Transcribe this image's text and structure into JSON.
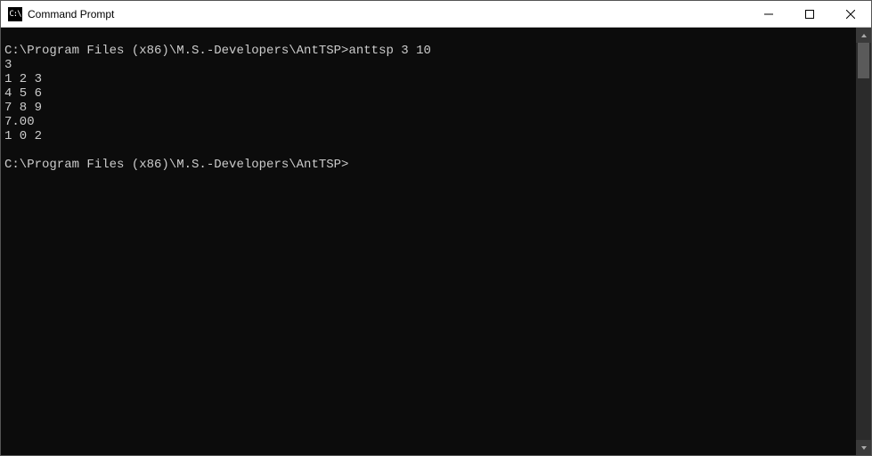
{
  "window": {
    "title": "Command Prompt",
    "icon_glyph": "C:\\"
  },
  "terminal": {
    "lines": [
      "",
      "C:\\Program Files (x86)\\M.S.-Developers\\AntTSP>anttsp 3 10",
      "3",
      "1 2 3",
      "4 5 6",
      "7 8 9",
      "7.00",
      "1 0 2",
      "",
      "C:\\Program Files (x86)\\M.S.-Developers\\AntTSP>"
    ]
  }
}
